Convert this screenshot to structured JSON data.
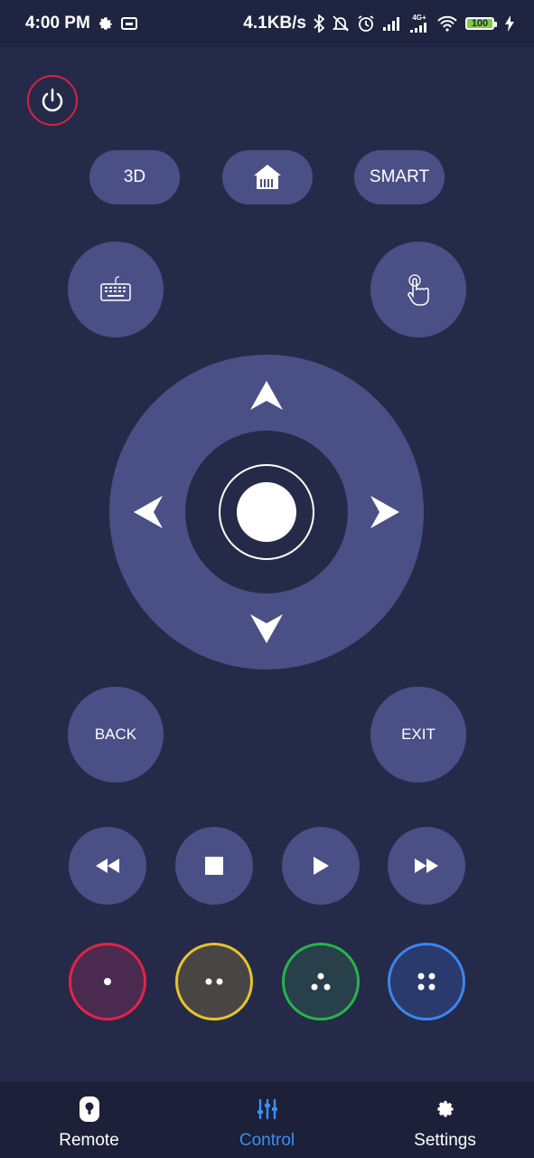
{
  "status_bar": {
    "time": "4:00 PM",
    "net_speed": "4.1KB/s",
    "network": "4G+",
    "battery": "100"
  },
  "remote": {
    "buttons": {
      "three_d": "3D",
      "smart": "SMART",
      "back": "BACK",
      "exit": "EXIT"
    },
    "color_buttons": [
      {
        "name": "red",
        "color": "#e2234a",
        "fill": "#4b2a50"
      },
      {
        "name": "yellow",
        "color": "#e6c42a",
        "fill": "#4a4545"
      },
      {
        "name": "green",
        "color": "#27b44a",
        "fill": "#284049"
      },
      {
        "name": "blue",
        "color": "#3a86f0",
        "fill": "#2b3a6c"
      }
    ]
  },
  "bottom_nav": {
    "items": [
      {
        "label": "Remote",
        "icon": "remote-icon",
        "active": false
      },
      {
        "label": "Control",
        "icon": "sliders-icon",
        "active": true
      },
      {
        "label": "Settings",
        "icon": "gear-icon",
        "active": false
      }
    ],
    "active_color": "#3d8ef0",
    "inactive_color": "#ffffff"
  },
  "colors": {
    "background": "#252a48",
    "button": "#4a5086",
    "power_ring": "#d6224a"
  }
}
